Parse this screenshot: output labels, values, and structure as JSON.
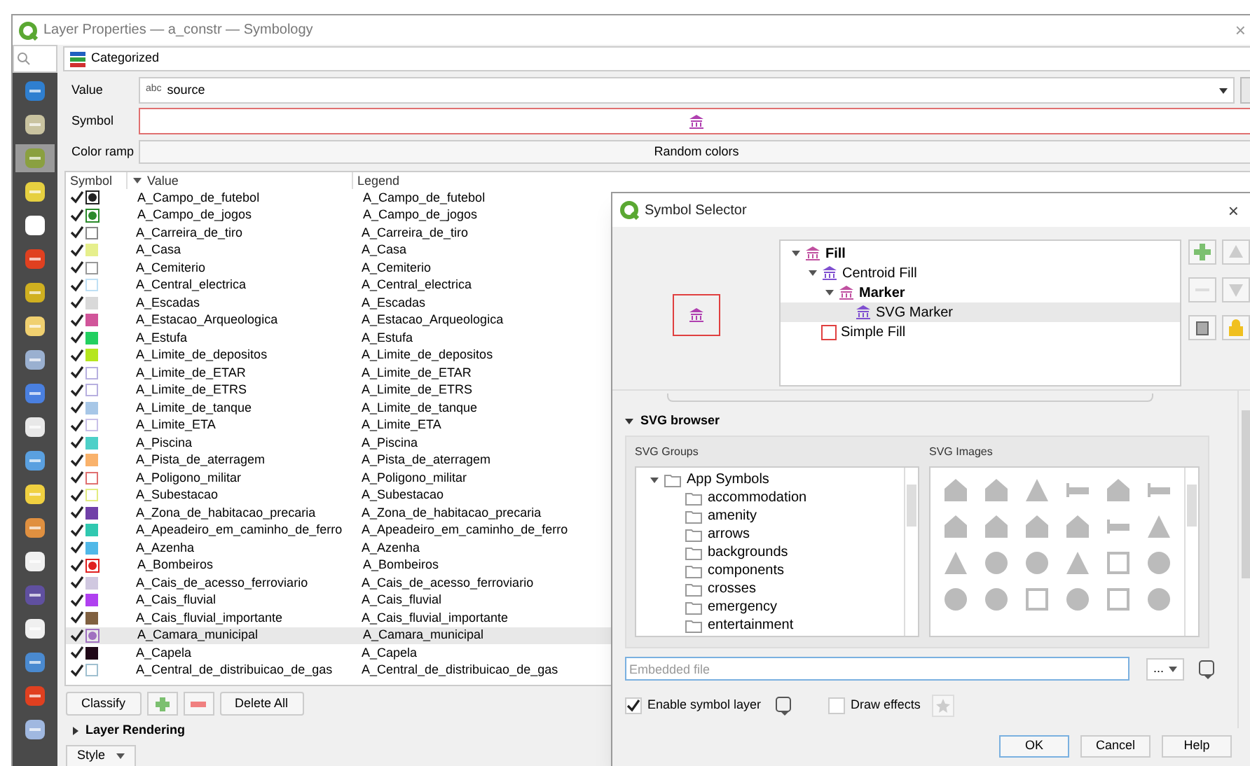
{
  "window": {
    "title": "Layer Properties — a_constr — Symbology",
    "close": "×"
  },
  "sidebar": {
    "items": [
      {
        "selected": false
      },
      {
        "selected": false
      },
      {
        "selected": true
      },
      {
        "selected": false
      },
      {
        "selected": false
      },
      {
        "selected": false
      },
      {
        "selected": false
      },
      {
        "selected": false
      },
      {
        "selected": false
      },
      {
        "selected": false
      },
      {
        "selected": false
      },
      {
        "selected": false
      },
      {
        "selected": false
      },
      {
        "selected": false
      },
      {
        "selected": false
      },
      {
        "selected": false
      },
      {
        "selected": false
      },
      {
        "selected": false
      },
      {
        "selected": false
      },
      {
        "selected": false
      }
    ]
  },
  "renderer": "Categorized",
  "form": {
    "value_label": "Value",
    "value_type": "abc",
    "value": "source",
    "symbol_label": "Symbol",
    "color_ramp_label": "Color ramp",
    "color_ramp": "Random colors"
  },
  "table": {
    "columns": [
      "Symbol",
      "Value",
      "Legend"
    ],
    "rows": [
      {
        "checked": true,
        "kind": "marker",
        "color": "#222222",
        "value": "A_Campo_de_futebol",
        "legend": "A_Campo_de_futebol",
        "selected": false
      },
      {
        "checked": true,
        "kind": "marker",
        "color": "#2a8a2a",
        "value": "A_Campo_de_jogos",
        "legend": "A_Campo_de_jogos",
        "selected": false
      },
      {
        "checked": true,
        "kind": "outline",
        "color": "#888888",
        "value": "A_Carreira_de_tiro",
        "legend": "A_Carreira_de_tiro",
        "selected": false
      },
      {
        "checked": true,
        "kind": "fill",
        "color": "#e6ef8c",
        "value": "A_Casa",
        "legend": "A_Casa",
        "selected": false
      },
      {
        "checked": true,
        "kind": "outline",
        "color": "#999999",
        "value": "A_Cemiterio",
        "legend": "A_Cemiterio",
        "selected": false
      },
      {
        "checked": true,
        "kind": "outline",
        "color": "#bfe0f5",
        "value": "A_Central_electrica",
        "legend": "A_Central_electrica",
        "selected": false
      },
      {
        "checked": true,
        "kind": "fill",
        "color": "#d9d9d9",
        "value": "A_Escadas",
        "legend": "A_Escadas",
        "selected": false
      },
      {
        "checked": true,
        "kind": "fill",
        "color": "#d1559a",
        "value": "A_Estacao_Arqueologica",
        "legend": "A_Estacao_Arqueologica",
        "selected": false
      },
      {
        "checked": true,
        "kind": "fill",
        "color": "#22d060",
        "value": "A_Estufa",
        "legend": "A_Estufa",
        "selected": false
      },
      {
        "checked": true,
        "kind": "fill",
        "color": "#b5e61d",
        "value": "A_Limite_de_depositos",
        "legend": "A_Limite_de_depositos",
        "selected": false
      },
      {
        "checked": true,
        "kind": "outline",
        "color": "#b8b0e0",
        "value": "A_Limite_de_ETAR",
        "legend": "A_Limite_de_ETAR",
        "selected": false
      },
      {
        "checked": true,
        "kind": "outline",
        "color": "#b8b0e0",
        "value": "A_Limite_de_ETRS",
        "legend": "A_Limite_de_ETRS",
        "selected": false
      },
      {
        "checked": true,
        "kind": "fill",
        "color": "#a7c7e7",
        "value": "A_Limite_de_tanque",
        "legend": "A_Limite_de_tanque",
        "selected": false
      },
      {
        "checked": true,
        "kind": "outline",
        "color": "#c8c0e8",
        "value": "A_Limite_ETA",
        "legend": "A_Limite_ETA",
        "selected": false
      },
      {
        "checked": true,
        "kind": "fill",
        "color": "#4dd0c8",
        "value": "A_Piscina",
        "legend": "A_Piscina",
        "selected": false
      },
      {
        "checked": true,
        "kind": "fill",
        "color": "#f9b26b",
        "value": "A_Pista_de_aterragem",
        "legend": "A_Pista_de_aterragem",
        "selected": false
      },
      {
        "checked": true,
        "kind": "outline",
        "color": "#e07070",
        "value": "A_Poligono_militar",
        "legend": "A_Poligono_militar",
        "selected": false
      },
      {
        "checked": true,
        "kind": "outline",
        "color": "#e2ec80",
        "value": "A_Subestacao",
        "legend": "A_Subestacao",
        "selected": false
      },
      {
        "checked": true,
        "kind": "fill",
        "color": "#7040a8",
        "value": "A_Zona_de_habitacao_precaria",
        "legend": "A_Zona_de_habitacao_precaria",
        "selected": false
      },
      {
        "checked": true,
        "kind": "fill",
        "color": "#30c8b0",
        "value": "A_Apeadeiro_em_caminho_de_ferro",
        "legend": "A_Apeadeiro_em_caminho_de_ferro",
        "selected": false
      },
      {
        "checked": true,
        "kind": "fill",
        "color": "#50b8e8",
        "value": "A_Azenha",
        "legend": "A_Azenha",
        "selected": false
      },
      {
        "checked": true,
        "kind": "marker",
        "color": "#e02020",
        "value": "A_Bombeiros",
        "legend": "A_Bombeiros",
        "selected": false
      },
      {
        "checked": true,
        "kind": "fill",
        "color": "#d0c8e0",
        "value": "A_Cais_de_acesso_ferroviario",
        "legend": "A_Cais_de_acesso_ferroviario",
        "selected": false
      },
      {
        "checked": true,
        "kind": "fill",
        "color": "#b040f0",
        "value": "A_Cais_fluvial",
        "legend": "A_Cais_fluvial",
        "selected": false
      },
      {
        "checked": true,
        "kind": "fill",
        "color": "#806040",
        "value": "A_Cais_fluvial_importante",
        "legend": "A_Cais_fluvial_importante",
        "selected": false
      },
      {
        "checked": true,
        "kind": "marker",
        "color": "#a070c0",
        "value": "A_Camara_municipal",
        "legend": "A_Camara_municipal",
        "selected": true
      },
      {
        "checked": true,
        "kind": "fill",
        "color": "#200818",
        "value": "A_Capela",
        "legend": "A_Capela",
        "selected": false
      },
      {
        "checked": true,
        "kind": "outline",
        "color": "#a0c0d0",
        "value": "A_Central_de_distribuicao_de_gas",
        "legend": "A_Central_de_distribuicao_de_gas",
        "selected": false
      }
    ]
  },
  "table_buttons": [
    "Classify",
    "Delete All"
  ],
  "layer_rendering": {
    "label": "Layer Rendering",
    "expanded": false
  },
  "style_button": "Style",
  "dialog": {
    "title": "Symbol Selector",
    "close": "×",
    "tree": [
      {
        "label": "Fill",
        "kind": "symbol",
        "expanded": true,
        "selected": false,
        "children": [
          {
            "label": "Centroid Fill",
            "kind": "layer",
            "expanded": true,
            "selected": false,
            "children": [
              {
                "label": "Marker",
                "kind": "symbol",
                "expanded": true,
                "selected": false,
                "children": [
                  {
                    "label": "SVG Marker",
                    "kind": "layer",
                    "selected": true
                  }
                ]
              }
            ]
          },
          {
            "label": "Simple Fill",
            "kind": "simple",
            "selected": false
          }
        ]
      }
    ],
    "svg_browser": {
      "label": "SVG browser",
      "expanded": true,
      "groups_label": "SVG Groups",
      "images_label": "SVG Images",
      "groups": [
        {
          "label": "App Symbols",
          "expanded": true,
          "children": [
            {
              "label": "accommodation"
            },
            {
              "label": "amenity"
            },
            {
              "label": "arrows"
            },
            {
              "label": "backgrounds"
            },
            {
              "label": "components"
            },
            {
              "label": "crosses"
            },
            {
              "label": "emergency"
            },
            {
              "label": "entertainment"
            }
          ]
        }
      ]
    },
    "file_placeholder": "Embedded file",
    "browse": "...",
    "enable_layer": {
      "label": "Enable symbol layer",
      "checked": true
    },
    "draw_effects": {
      "label": "Draw effects",
      "checked": false
    },
    "buttons": [
      "OK",
      "Cancel",
      "Help"
    ]
  }
}
